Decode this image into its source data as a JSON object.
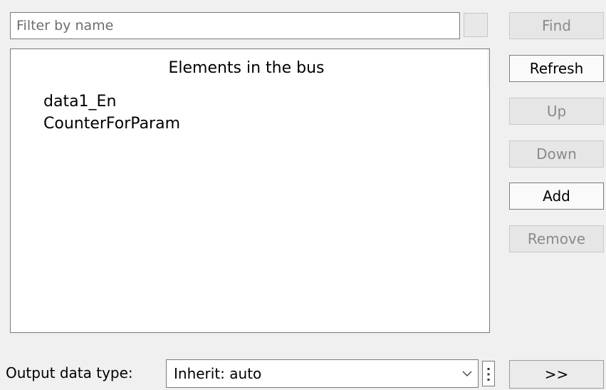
{
  "filter": {
    "placeholder": "Filter by name",
    "value": ""
  },
  "bus_list": {
    "header": "Elements in the bus",
    "items": [
      "data1_En",
      "CounterForParam"
    ]
  },
  "buttons": {
    "find": "Find",
    "refresh": "Refresh",
    "up": "Up",
    "down": "Down",
    "add": "Add",
    "remove": "Remove",
    "expand": ">>"
  },
  "output": {
    "label": "Output data type:",
    "value": "Inherit: auto"
  },
  "icons": {
    "dropdown": "chevron-down-icon",
    "more": "more-vertical-icon"
  },
  "colors": {
    "background": "#f0f0f0",
    "panel": "#ffffff",
    "border": "#7a7a7a",
    "disabled_text": "#8a8a8a",
    "disabled_button": "#e6e6e6"
  }
}
